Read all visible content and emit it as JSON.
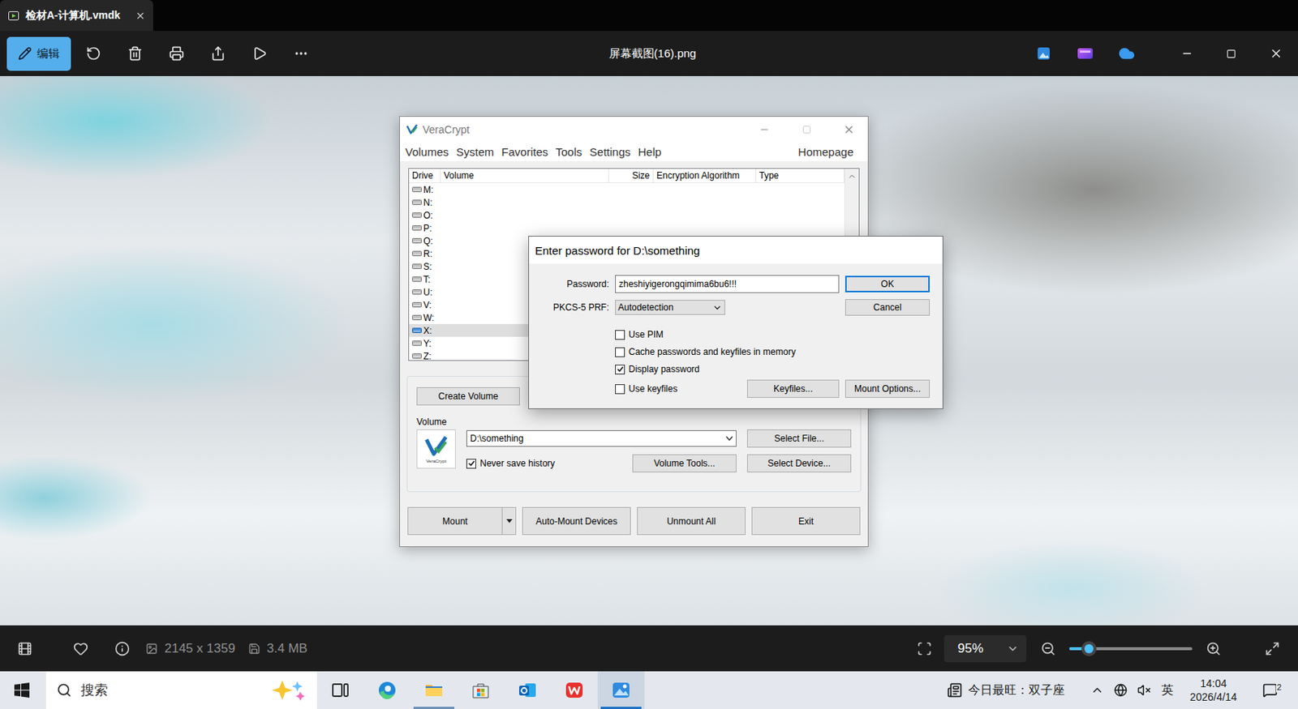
{
  "window": {
    "tab_title": "检材A-计算机.vmdk"
  },
  "toolbar": {
    "edit_label": "编辑",
    "file_name": "屏幕截图(16).png"
  },
  "viewer": {
    "veracrypt": {
      "title": "VeraCrypt",
      "menu": [
        "Volumes",
        "System",
        "Favorites",
        "Tools",
        "Settings",
        "Help"
      ],
      "homepage": "Homepage",
      "columns": [
        "Drive",
        "Volume",
        "Size",
        "Encryption Algorithm",
        "Type"
      ],
      "drives": [
        {
          "letter": "M:",
          "selected": false
        },
        {
          "letter": "N:",
          "selected": false
        },
        {
          "letter": "O:",
          "selected": false
        },
        {
          "letter": "P:",
          "selected": false
        },
        {
          "letter": "Q:",
          "selected": false
        },
        {
          "letter": "R:",
          "selected": false
        },
        {
          "letter": "S:",
          "selected": false
        },
        {
          "letter": "T:",
          "selected": false
        },
        {
          "letter": "U:",
          "selected": false
        },
        {
          "letter": "V:",
          "selected": false
        },
        {
          "letter": "W:",
          "selected": false
        },
        {
          "letter": "X:",
          "selected": true
        },
        {
          "letter": "Y:",
          "selected": false
        },
        {
          "letter": "Z:",
          "selected": false
        }
      ],
      "create_volume": "Create Volume",
      "volume_label": "Volume",
      "logo_caption": "VeraCrypt",
      "volume_path": "D:\\something",
      "select_file": "Select File...",
      "never_save_history": {
        "label": "Never save history",
        "checked": true
      },
      "volume_tools": "Volume Tools...",
      "select_device": "Select Device...",
      "buttons": [
        "Mount",
        "Auto-Mount Devices",
        "Unmount All",
        "Exit"
      ]
    },
    "password_dialog": {
      "title": "Enter password for D:\\something",
      "password_label": "Password:",
      "password": "zheshiyigerongqimima6bu6!!!",
      "prf_label": "PKCS-5 PRF:",
      "prf_value": "Autodetection",
      "ok": "OK",
      "cancel": "Cancel",
      "options": [
        {
          "label": "Use PIM",
          "checked": false
        },
        {
          "label": "Cache passwords and keyfiles in memory",
          "checked": false
        },
        {
          "label": "Display password",
          "checked": true
        },
        {
          "label": "Use keyfiles",
          "checked": false
        }
      ],
      "keyfiles": "Keyfiles...",
      "mount_options": "Mount Options..."
    }
  },
  "info_bar": {
    "dimensions": "2145 x 1359",
    "file_size": "3.4 MB",
    "zoom": "95%",
    "zoom_level": 0.16
  },
  "taskbar": {
    "search_placeholder": "搜索",
    "apps": [
      {
        "kind": "task-view",
        "running": false,
        "active": false
      },
      {
        "kind": "edge",
        "running": false,
        "active": false
      },
      {
        "kind": "explorer",
        "running": true,
        "active": false
      },
      {
        "kind": "store",
        "running": false,
        "active": false
      },
      {
        "kind": "outlook",
        "running": false,
        "active": false
      },
      {
        "kind": "wps",
        "running": false,
        "active": false
      },
      {
        "kind": "photos",
        "running": true,
        "active": true
      }
    ],
    "widget": "今日最旺：双子座",
    "input_method": "英",
    "time": "14:04",
    "date": "2026/4/14",
    "notifications": "2"
  }
}
